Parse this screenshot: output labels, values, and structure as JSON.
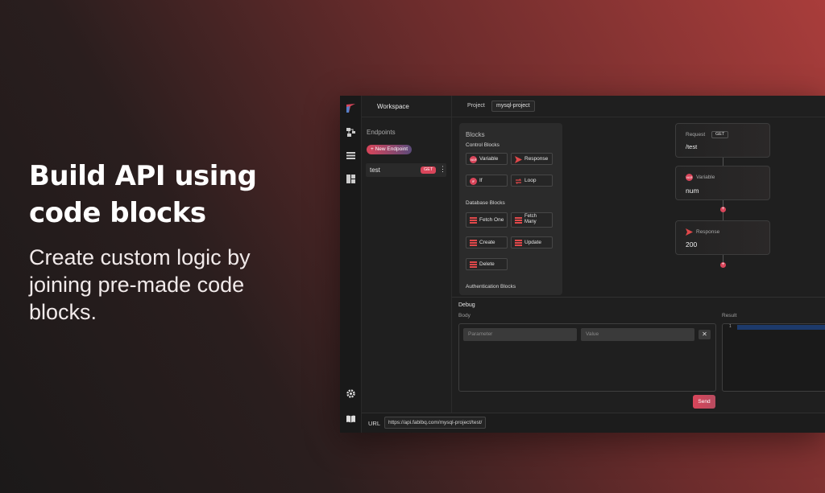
{
  "hero": {
    "title": "Build API using code blocks",
    "subtitle": "Create custom logic by joining pre-made code blocks."
  },
  "colors": {
    "accent": "#d9455a",
    "panel": "#1f1f1f",
    "block_bg": "#2b2b2b"
  },
  "rail": {
    "icons": [
      "logo-icon",
      "nodes-icon",
      "list-icon",
      "dashboard-icon",
      "gear-icon",
      "book-icon"
    ]
  },
  "sidebar": {
    "header": "Workspace",
    "endpoints_label": "Endpoints",
    "new_endpoint": "+ New Endpoint",
    "endpoints": [
      {
        "name": "test",
        "method": "GET",
        "menu": "⋮"
      }
    ]
  },
  "topbar": {
    "project_label": "Project",
    "project_value": "mysql-project"
  },
  "blocks": {
    "title": "Blocks",
    "control_label": "Control Blocks",
    "control": [
      {
        "label": "Variable",
        "icon": "var-icon",
        "icon_text": "VAR"
      },
      {
        "label": "Response",
        "icon": "send-icon"
      },
      {
        "label": "If",
        "icon": "if-icon",
        "icon_text": "IF"
      },
      {
        "label": "Loop",
        "icon": "loop-icon"
      }
    ],
    "database_label": "Database Blocks",
    "database": [
      {
        "label": "Fetch One",
        "icon": "database-icon"
      },
      {
        "label": "Fetch Many",
        "icon": "database-icon"
      },
      {
        "label": "Create",
        "icon": "database-icon"
      },
      {
        "label": "Update",
        "icon": "database-icon"
      },
      {
        "label": "Delete",
        "icon": "database-icon"
      }
    ],
    "auth_label": "Authentication Blocks"
  },
  "canvas": {
    "request": {
      "label": "Request",
      "method": "GET",
      "path": "/test"
    },
    "variable": {
      "label": "Variable",
      "icon_text": "VAR",
      "value": "num"
    },
    "response": {
      "label": "Response",
      "value": "200"
    },
    "plus": "+"
  },
  "debug": {
    "title": "Debug",
    "body_label": "Body",
    "result_label": "Result",
    "param_placeholder": "Parameter",
    "value_placeholder": "Value",
    "remove": "✕",
    "line_number": "1",
    "send": "Send"
  },
  "url": {
    "label": "URL",
    "value": "https://api.fablbq.com/mysql-project/test/"
  }
}
